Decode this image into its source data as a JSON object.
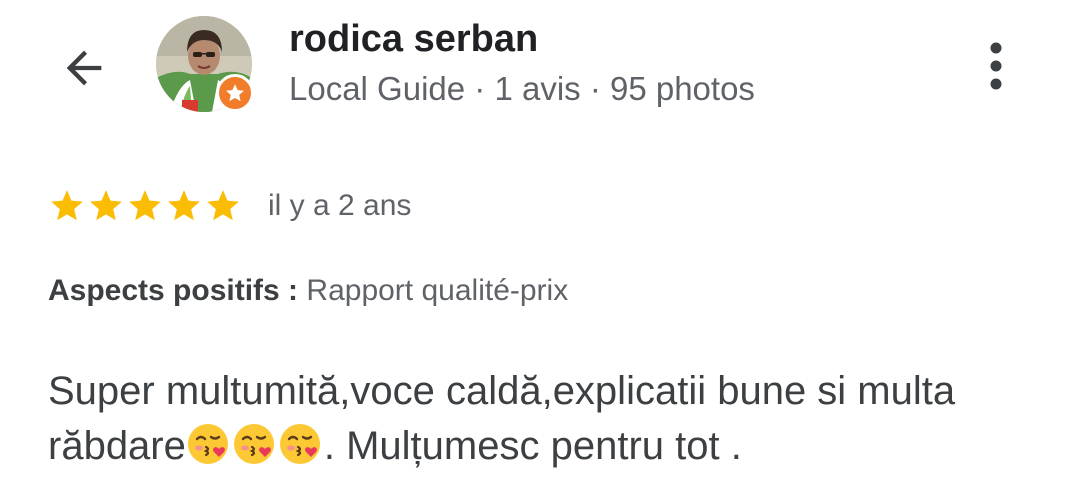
{
  "header": {
    "back_icon": "arrow-left-icon",
    "more_icon": "more-vert-icon"
  },
  "user": {
    "name": "rodica serban",
    "meta": "Local Guide · 1 avis · 95 photos",
    "badge_icon": "local-guide-star-icon",
    "badge_color": "#f17d2b"
  },
  "review": {
    "rating": 5,
    "max_rating": 5,
    "star_color": "#fbbc04",
    "time": "il y a 2 ans",
    "positives_label": "Aspects positifs :",
    "positives_value": "Rapport qualité-prix",
    "text_part1": "Super multumită,voce caldă,explicatii bune si multa răbdare",
    "emoji_name": "face-blowing-kiss-emoji",
    "emoji_count": 3,
    "text_part2": ". Mulțumesc pentru tot ."
  }
}
